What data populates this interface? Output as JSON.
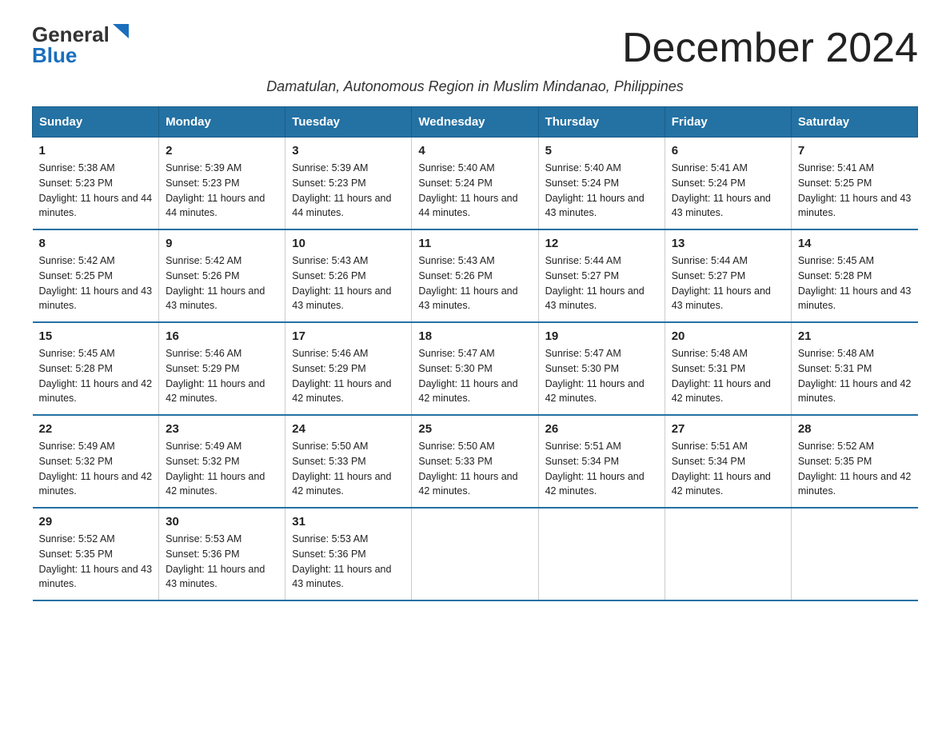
{
  "logo": {
    "general": "General",
    "blue": "Blue",
    "triangle": true
  },
  "title": "December 2024",
  "subtitle": "Damatulan, Autonomous Region in Muslim Mindanao, Philippines",
  "days_of_week": [
    "Sunday",
    "Monday",
    "Tuesday",
    "Wednesday",
    "Thursday",
    "Friday",
    "Saturday"
  ],
  "weeks": [
    [
      {
        "day": "1",
        "sunrise": "5:38 AM",
        "sunset": "5:23 PM",
        "daylight": "11 hours and 44 minutes."
      },
      {
        "day": "2",
        "sunrise": "5:39 AM",
        "sunset": "5:23 PM",
        "daylight": "11 hours and 44 minutes."
      },
      {
        "day": "3",
        "sunrise": "5:39 AM",
        "sunset": "5:23 PM",
        "daylight": "11 hours and 44 minutes."
      },
      {
        "day": "4",
        "sunrise": "5:40 AM",
        "sunset": "5:24 PM",
        "daylight": "11 hours and 44 minutes."
      },
      {
        "day": "5",
        "sunrise": "5:40 AM",
        "sunset": "5:24 PM",
        "daylight": "11 hours and 43 minutes."
      },
      {
        "day": "6",
        "sunrise": "5:41 AM",
        "sunset": "5:24 PM",
        "daylight": "11 hours and 43 minutes."
      },
      {
        "day": "7",
        "sunrise": "5:41 AM",
        "sunset": "5:25 PM",
        "daylight": "11 hours and 43 minutes."
      }
    ],
    [
      {
        "day": "8",
        "sunrise": "5:42 AM",
        "sunset": "5:25 PM",
        "daylight": "11 hours and 43 minutes."
      },
      {
        "day": "9",
        "sunrise": "5:42 AM",
        "sunset": "5:26 PM",
        "daylight": "11 hours and 43 minutes."
      },
      {
        "day": "10",
        "sunrise": "5:43 AM",
        "sunset": "5:26 PM",
        "daylight": "11 hours and 43 minutes."
      },
      {
        "day": "11",
        "sunrise": "5:43 AM",
        "sunset": "5:26 PM",
        "daylight": "11 hours and 43 minutes."
      },
      {
        "day": "12",
        "sunrise": "5:44 AM",
        "sunset": "5:27 PM",
        "daylight": "11 hours and 43 minutes."
      },
      {
        "day": "13",
        "sunrise": "5:44 AM",
        "sunset": "5:27 PM",
        "daylight": "11 hours and 43 minutes."
      },
      {
        "day": "14",
        "sunrise": "5:45 AM",
        "sunset": "5:28 PM",
        "daylight": "11 hours and 43 minutes."
      }
    ],
    [
      {
        "day": "15",
        "sunrise": "5:45 AM",
        "sunset": "5:28 PM",
        "daylight": "11 hours and 42 minutes."
      },
      {
        "day": "16",
        "sunrise": "5:46 AM",
        "sunset": "5:29 PM",
        "daylight": "11 hours and 42 minutes."
      },
      {
        "day": "17",
        "sunrise": "5:46 AM",
        "sunset": "5:29 PM",
        "daylight": "11 hours and 42 minutes."
      },
      {
        "day": "18",
        "sunrise": "5:47 AM",
        "sunset": "5:30 PM",
        "daylight": "11 hours and 42 minutes."
      },
      {
        "day": "19",
        "sunrise": "5:47 AM",
        "sunset": "5:30 PM",
        "daylight": "11 hours and 42 minutes."
      },
      {
        "day": "20",
        "sunrise": "5:48 AM",
        "sunset": "5:31 PM",
        "daylight": "11 hours and 42 minutes."
      },
      {
        "day": "21",
        "sunrise": "5:48 AM",
        "sunset": "5:31 PM",
        "daylight": "11 hours and 42 minutes."
      }
    ],
    [
      {
        "day": "22",
        "sunrise": "5:49 AM",
        "sunset": "5:32 PM",
        "daylight": "11 hours and 42 minutes."
      },
      {
        "day": "23",
        "sunrise": "5:49 AM",
        "sunset": "5:32 PM",
        "daylight": "11 hours and 42 minutes."
      },
      {
        "day": "24",
        "sunrise": "5:50 AM",
        "sunset": "5:33 PM",
        "daylight": "11 hours and 42 minutes."
      },
      {
        "day": "25",
        "sunrise": "5:50 AM",
        "sunset": "5:33 PM",
        "daylight": "11 hours and 42 minutes."
      },
      {
        "day": "26",
        "sunrise": "5:51 AM",
        "sunset": "5:34 PM",
        "daylight": "11 hours and 42 minutes."
      },
      {
        "day": "27",
        "sunrise": "5:51 AM",
        "sunset": "5:34 PM",
        "daylight": "11 hours and 42 minutes."
      },
      {
        "day": "28",
        "sunrise": "5:52 AM",
        "sunset": "5:35 PM",
        "daylight": "11 hours and 42 minutes."
      }
    ],
    [
      {
        "day": "29",
        "sunrise": "5:52 AM",
        "sunset": "5:35 PM",
        "daylight": "11 hours and 43 minutes."
      },
      {
        "day": "30",
        "sunrise": "5:53 AM",
        "sunset": "5:36 PM",
        "daylight": "11 hours and 43 minutes."
      },
      {
        "day": "31",
        "sunrise": "5:53 AM",
        "sunset": "5:36 PM",
        "daylight": "11 hours and 43 minutes."
      },
      null,
      null,
      null,
      null
    ]
  ],
  "colors": {
    "header_bg": "#2471a3",
    "header_text": "#ffffff",
    "accent_blue": "#1a6ebd"
  }
}
